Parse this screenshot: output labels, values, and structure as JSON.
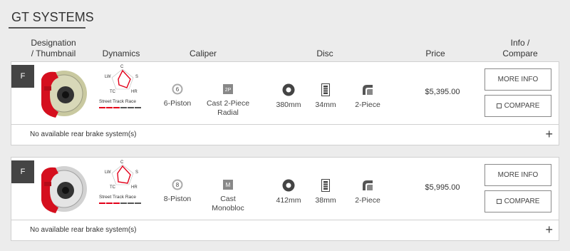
{
  "section_title": "GT SYSTEMS",
  "headers": {
    "designation": "Designation\n/ Thumbnail",
    "dynamics": "Dynamics",
    "caliper": "Caliper",
    "disc": "Disc",
    "price": "Price",
    "info": "Info /\nCompare"
  },
  "products": [
    {
      "position_badge": "F",
      "dynamics": {
        "c": "C",
        "lw": "LW",
        "s": "S",
        "tc": "TC",
        "hr": "HR",
        "scale": "Street Track Race",
        "level": 3
      },
      "caliper_pistons": "6-Piston",
      "caliper_pistons_glyph": "6",
      "caliper_type": "Cast 2-Piece Radial",
      "caliper_type_glyph": "2P",
      "disc_diameter": "380mm",
      "disc_thickness": "34mm",
      "disc_construction": "2-Piece",
      "price": "$5,395.00",
      "more_info_label": "MORE INFO",
      "compare_label": "COMPARE",
      "rear_text": "No available rear brake system(s)",
      "expand_glyph": "+"
    },
    {
      "position_badge": "F",
      "dynamics": {
        "c": "C",
        "lw": "LW",
        "s": "S",
        "tc": "TC",
        "hr": "HR",
        "scale": "Street Track Race",
        "level": 3
      },
      "caliper_pistons": "8-Piston",
      "caliper_pistons_glyph": "8",
      "caliper_type": "Cast Monobloc",
      "caliper_type_glyph": "M",
      "disc_diameter": "412mm",
      "disc_thickness": "38mm",
      "disc_construction": "2-Piece",
      "price": "$5,995.00",
      "more_info_label": "MORE INFO",
      "compare_label": "COMPARE",
      "rear_text": "No available rear brake system(s)",
      "expand_glyph": "+"
    }
  ],
  "colors": {
    "accent_red": "#e2001a",
    "badge_bg": "#444444",
    "bar_inactive": "#555555"
  }
}
